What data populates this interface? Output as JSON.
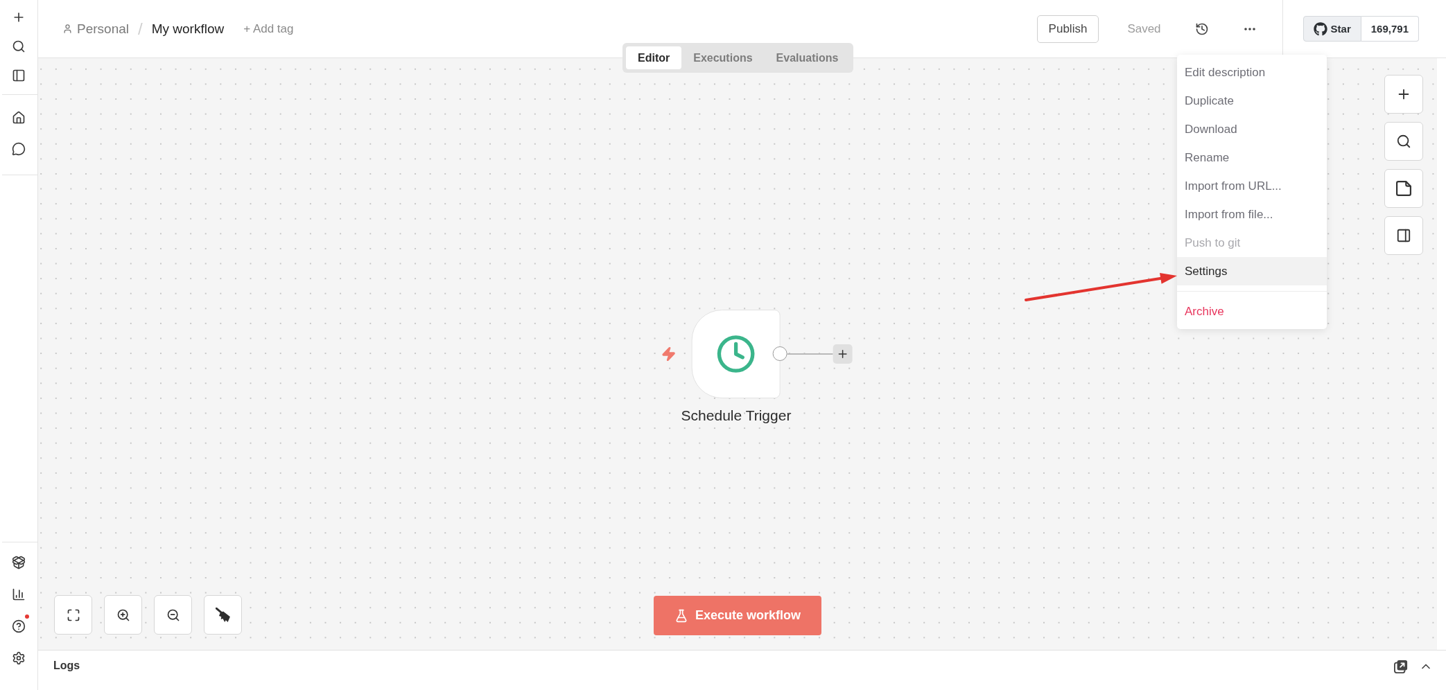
{
  "header": {
    "project": "Personal",
    "separator": "/",
    "workflow_name": "My workflow",
    "add_tag": "+ Add tag",
    "publish_button": "Publish",
    "save_status": "Saved",
    "github": {
      "star_label": "Star",
      "star_count": "169,791"
    }
  },
  "tabs": [
    {
      "label": "Editor",
      "selected": true
    },
    {
      "label": "Executions",
      "selected": false
    },
    {
      "label": "Evaluations",
      "selected": false
    }
  ],
  "menu": {
    "sections": [
      {
        "items": [
          {
            "label": "Edit description",
            "kind": "action",
            "selected": false,
            "disabled": false
          },
          {
            "label": "Duplicate",
            "kind": "action",
            "selected": false,
            "disabled": false
          },
          {
            "label": "Download",
            "kind": "action",
            "selected": false,
            "disabled": false
          },
          {
            "label": "Rename",
            "kind": "action",
            "selected": false,
            "disabled": false
          },
          {
            "label": "Import from URL...",
            "kind": "action",
            "selected": false,
            "disabled": false
          },
          {
            "label": "Import from file...",
            "kind": "action",
            "selected": false,
            "disabled": false
          },
          {
            "label": "Push to git",
            "kind": "action",
            "selected": false,
            "disabled": true
          },
          {
            "label": "Settings",
            "kind": "action",
            "selected": true,
            "disabled": false
          }
        ]
      },
      {
        "items": [
          {
            "label": "Archive",
            "kind": "danger",
            "selected": false,
            "disabled": false
          }
        ]
      }
    ]
  },
  "annotations": [
    {
      "kind": "arrow"
    }
  ],
  "sidebar": {
    "help_badge": true
  },
  "canvas": {
    "nodes": [
      {
        "label": "Schedule Trigger",
        "kind": "trigger"
      }
    ],
    "execute_button": "Execute workflow"
  },
  "logs": {
    "title": "Logs"
  }
}
